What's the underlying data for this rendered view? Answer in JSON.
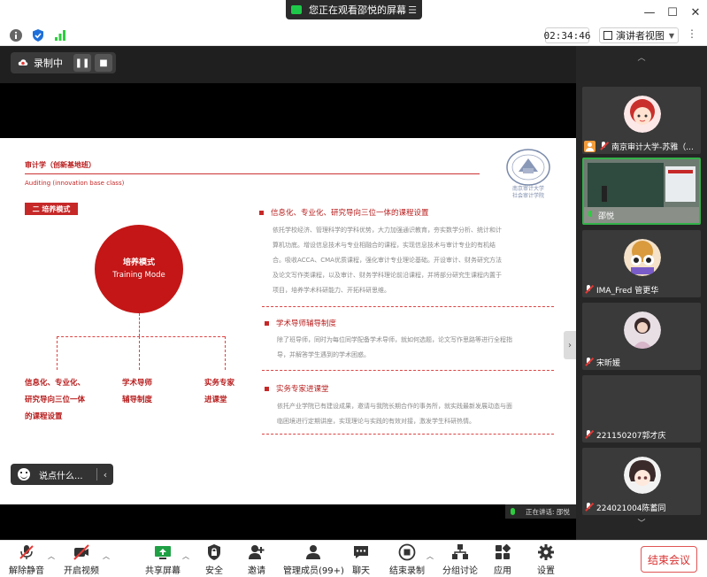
{
  "window": {
    "share_banner": "您正在观看邵悦的屏幕",
    "controls": [
      "minimize",
      "maximize",
      "close"
    ]
  },
  "infobar": {
    "timer": "02:34:46",
    "view_label": "演讲者视图"
  },
  "recording": {
    "label": "录制中"
  },
  "slide": {
    "title": "审计学（创新基地班）",
    "subtitle": "Auditing (innovation base class)",
    "logo_text_1": "南京审计大学",
    "logo_text_2": "社会审计学院",
    "section_tag": "二 培养模式",
    "circle_cn": "培养模式",
    "circle_en": "Training Mode",
    "leaf1_l1": "信息化、专业化、",
    "leaf1_l2": "研究导向三位一体",
    "leaf1_l3": "的课程设置",
    "leaf2_l1": "学术导师",
    "leaf2_l2": "辅导制度",
    "leaf3_l1": "实务专家",
    "leaf3_l2": "进课堂",
    "b1_title": "信息化、专业化、研究导向三位一体的课程设置",
    "b1_l1": "依托学校经济、管理科学的学科优势，大力加强通识教育，夯实数学分析、统计和计",
    "b1_l2": "算机功底。增设信息技术与专业相融合的课程，实现信息技术与审计专业的有机结",
    "b1_l3": "合。吸收ACCA、CMA优质课程，强化审计专业理论基础。开设审计、财务研究方法",
    "b1_l4": "及论文写作类课程，以及审计、财务学科理论前沿课程，并将部分研究生课程内置于",
    "b1_l5": "项目，培养学术科研能力、开拓科研思维。",
    "b2_title": "学术导师辅导制度",
    "b2_l1": "除了班导师，同时为每位同学配备学术导师，就如何选题，论文写作思路等进行全程指",
    "b2_l2": "导，并解答学生遇到的学术困惑。",
    "b3_title": "实务专家进课堂",
    "b3_l1": "依托产业学院已有建设成果，邀请与我院长期合作的事务所，就实践最新发展动态与面",
    "b3_l2": "临困境进行定期讲座，实现理论与实践的有效对接，激发学生科研热情。"
  },
  "chat": {
    "placeholder": "说点什么..."
  },
  "speaking": {
    "label": "正在讲话: 邵悦"
  },
  "participants": [
    {
      "name": "南京审计大学-苏雅（..."
    },
    {
      "name": "邵悦"
    },
    {
      "name": "IMA_Fred 管更华"
    },
    {
      "name": "宋昕媛"
    },
    {
      "name": "221150207郭才庆"
    },
    {
      "name": "224021004陈蓄同"
    }
  ],
  "toolbar": {
    "mute": "解除静音",
    "video": "开启视频",
    "share": "共享屏幕",
    "security": "安全",
    "invite": "邀请",
    "participants": "管理成员(99+)",
    "chat": "聊天",
    "record": "结束录制",
    "breakout": "分组讨论",
    "apps": "应用",
    "settings": "设置",
    "end": "结束会议"
  },
  "colors": {
    "accent_red": "#c62828",
    "active_green": "#33b249",
    "end_red": "#d93030"
  }
}
